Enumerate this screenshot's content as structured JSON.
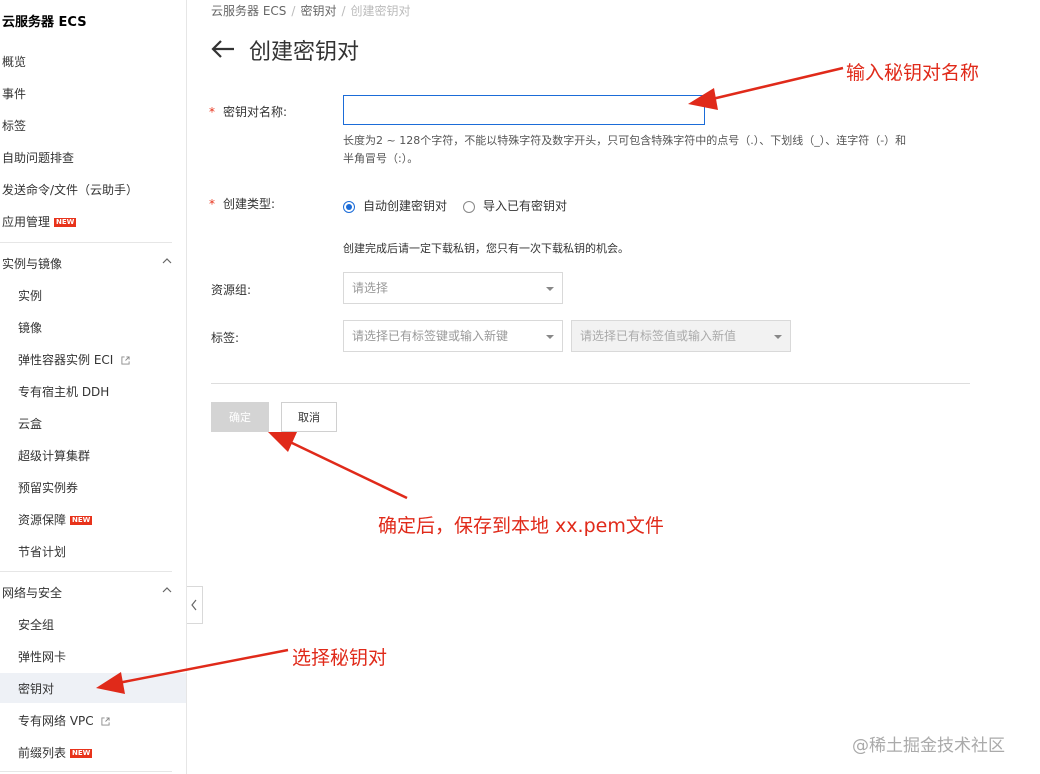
{
  "sidebar": {
    "title": "云服务器 ECS",
    "top_items": [
      {
        "label": "概览"
      },
      {
        "label": "事件"
      },
      {
        "label": "标签"
      },
      {
        "label": "自助问题排查"
      },
      {
        "label": "发送命令/文件（云助手）"
      },
      {
        "label": "应用管理",
        "badge": "NEW"
      }
    ],
    "groups": [
      {
        "label": "实例与镜像",
        "items": [
          {
            "label": "实例"
          },
          {
            "label": "镜像"
          },
          {
            "label": "弹性容器实例 ECI",
            "external": true
          },
          {
            "label": "专有宿主机 DDH"
          },
          {
            "label": "云盒"
          },
          {
            "label": "超级计算集群"
          },
          {
            "label": "预留实例券"
          },
          {
            "label": "资源保障",
            "badge": "NEW"
          },
          {
            "label": "节省计划"
          }
        ]
      },
      {
        "label": "网络与安全",
        "items": [
          {
            "label": "安全组"
          },
          {
            "label": "弹性网卡"
          },
          {
            "label": "密钥对",
            "active": true
          },
          {
            "label": "专有网络 VPC",
            "external": true
          },
          {
            "label": "前缀列表",
            "badge": "NEW"
          }
        ]
      }
    ],
    "badge_text": "NEW"
  },
  "breadcrumb": {
    "items": [
      "云服务器 ECS",
      "密钥对",
      "创建密钥对"
    ],
    "separator": "/"
  },
  "page": {
    "title": "创建密钥对"
  },
  "form": {
    "name_label": "密钥对名称:",
    "name_value": "",
    "name_help": "长度为2 ~ 128个字符，不能以特殊字符及数字开头，只可包含特殊字符中的点号（.）、下划线（_）、连字符（-）和半角冒号（:）。",
    "type_label": "创建类型:",
    "type_options": [
      "自动创建密钥对",
      "导入已有密钥对"
    ],
    "type_selected": "自动创建密钥对",
    "type_note": "创建完成后请一定下载私钥，您只有一次下载私钥的机会。",
    "resource_group_label": "资源组:",
    "resource_group_placeholder": "请选择",
    "tag_label": "标签:",
    "tag_key_placeholder": "请选择已有标签键或输入新键",
    "tag_value_placeholder": "请选择已有标签值或输入新值",
    "required_mark": "*",
    "ok_label": "确定",
    "cancel_label": "取消"
  },
  "annotations": {
    "name_hint": "输入秘钥对名称",
    "ok_hint": "确定后，保存到本地 xx.pem文件",
    "sidebar_hint": "选择秘钥对",
    "color": "#e02a1a"
  },
  "watermark": "@稀土掘金技术社区",
  "colors": {
    "accent": "#1b6cd8",
    "required": "#e8331b",
    "badge": "#e8331b"
  }
}
